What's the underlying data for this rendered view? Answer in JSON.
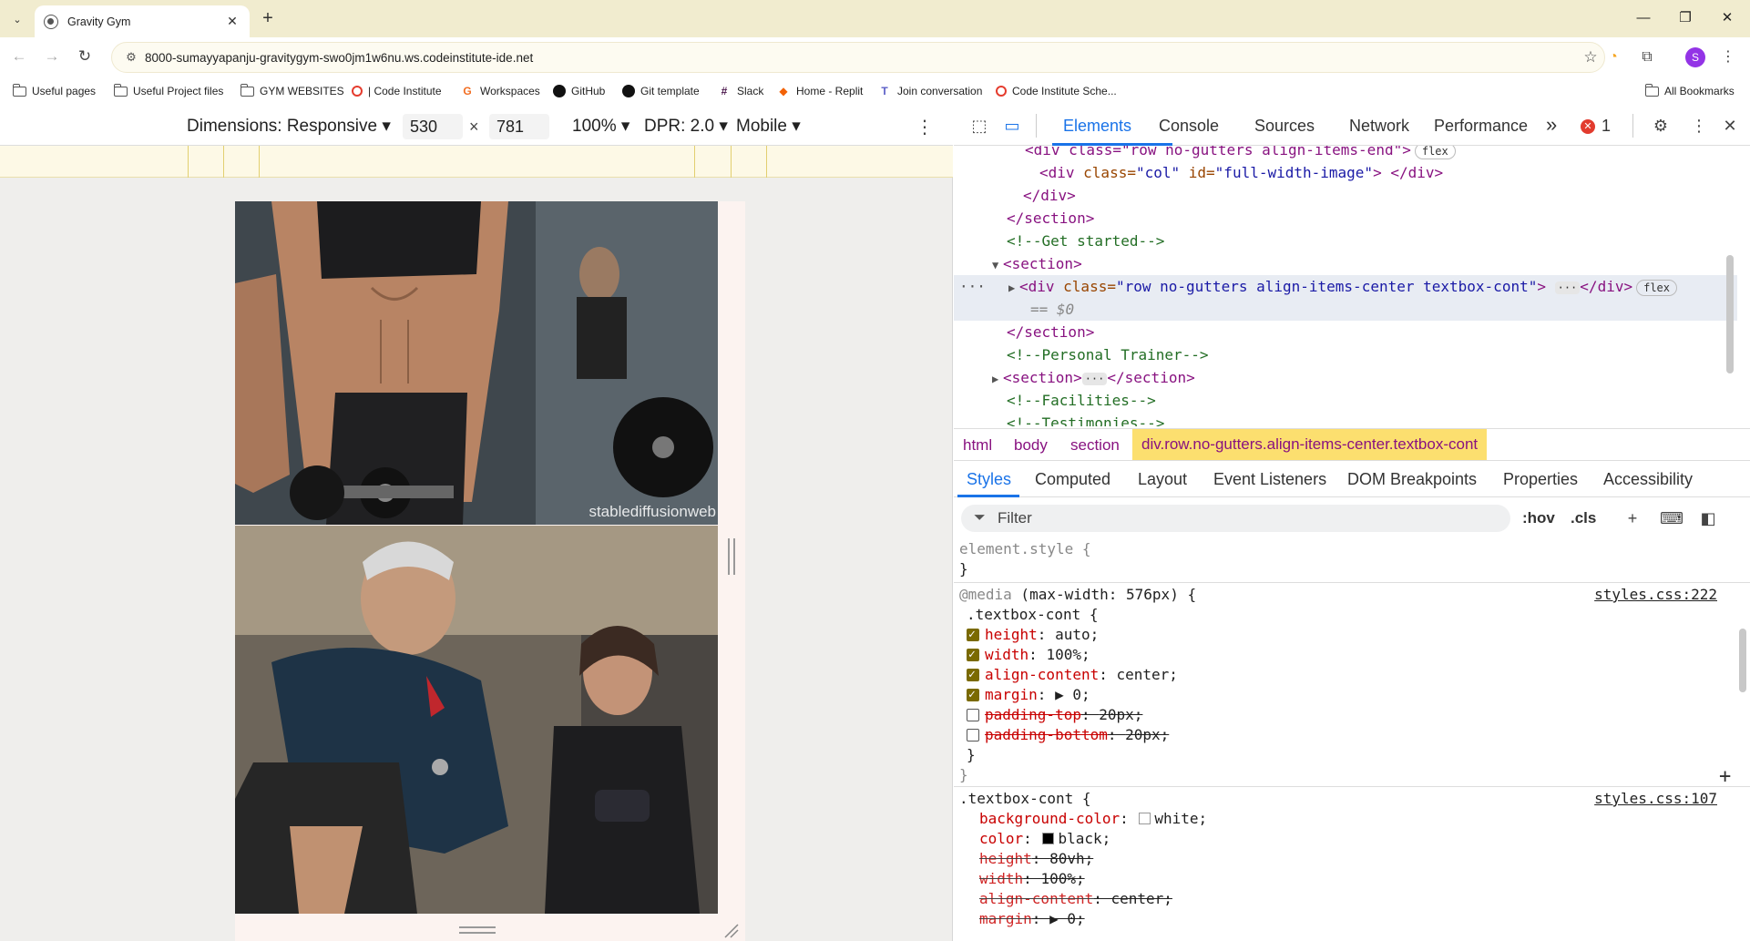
{
  "browser": {
    "tab_title": "Gravity Gym",
    "url": "8000-sumayyapanju-gravitygym-swo0jm1w6nu.ws.codeinstitute-ide.net",
    "avatar_letter": "S",
    "bookmarks": [
      {
        "label": "Useful pages",
        "icon": "folder-icon"
      },
      {
        "label": "Useful Project files",
        "icon": "folder-icon"
      },
      {
        "label": "GYM WEBSITES",
        "icon": "folder-icon"
      },
      {
        "label": "| Code Institute",
        "icon": "code-institute-icon"
      },
      {
        "label": "Workspaces",
        "icon": "workspaces-icon"
      },
      {
        "label": "GitHub",
        "icon": "github-icon"
      },
      {
        "label": "Git template",
        "icon": "github-icon"
      },
      {
        "label": "Slack",
        "icon": "slack-icon"
      },
      {
        "label": "Home - Replit",
        "icon": "replit-icon"
      },
      {
        "label": "Join conversation",
        "icon": "teams-icon"
      },
      {
        "label": "Code Institute Sche...",
        "icon": "code-institute-icon"
      }
    ],
    "all_bookmarks": "All Bookmarks"
  },
  "emulation": {
    "dimensions_label": "Dimensions: Responsive",
    "width": "530",
    "height": "781",
    "times": "×",
    "zoom": "100%",
    "dpr": "DPR: 2.0",
    "mode": "Mobile",
    "watermark": "stablediffusionweb"
  },
  "devtools": {
    "tabs": [
      "Elements",
      "Console",
      "Sources",
      "Network",
      "Performance"
    ],
    "more": "»",
    "error_count": "1",
    "dom": [
      {
        "type": "partial",
        "text": "<div class=\"row no-gutters align-items-end\">",
        "pill": "flex"
      },
      {
        "type": "tag",
        "indent": 2,
        "open": "<div",
        "attr1": " class=",
        "val1": "\"col\"",
        "attr2": " id=",
        "val2": "\"full-width-image\"",
        "close": "> </div>"
      },
      {
        "type": "plain",
        "indent": 1,
        "text": "</div>"
      },
      {
        "type": "plain",
        "indent": 0,
        "text": "</section>"
      },
      {
        "type": "comment",
        "indent": 0,
        "text": "<!--Get started-->"
      },
      {
        "type": "plain",
        "indent": 0,
        "text": "<section>",
        "triangle": "down"
      },
      {
        "type": "selected",
        "indent": 1,
        "open": "<div",
        "attr1": " class=",
        "val1": "\"row no-gutters align-items-center textbox-cont\"",
        "close": "> ",
        "dots": "···",
        "end": "</div>",
        "pill": "flex"
      },
      {
        "type": "eq",
        "text": "== $0"
      },
      {
        "type": "plain",
        "indent": 0,
        "text": "</section>"
      },
      {
        "type": "comment",
        "indent": 0,
        "text": "<!--Personal Trainer-->"
      },
      {
        "type": "collapsed",
        "indent": 0,
        "text": "<section>",
        "dots": "···",
        "end": "</section>"
      },
      {
        "type": "comment",
        "indent": 0,
        "text": "<!--Facilities-->"
      },
      {
        "type": "comment",
        "indent": 0,
        "text": "<!--Testimonies-->"
      }
    ],
    "breadcrumbs": [
      "html",
      "body",
      "section",
      "div.row.no-gutters.align-items-center.textbox-cont"
    ],
    "style_tabs": [
      "Styles",
      "Computed",
      "Layout",
      "Event Listeners",
      "DOM Breakpoints",
      "Properties",
      "Accessibility"
    ],
    "filter_placeholder": "Filter",
    "hov": ":hov",
    "cls": ".cls",
    "element_style": "element.style {",
    "close_brace": "}",
    "media_rule": {
      "at": "@media",
      "query": " (max-width: 576px) {",
      "source": "styles.css:222",
      "selector": ".textbox-cont {",
      "props": [
        {
          "name": "height",
          "value": "auto;",
          "checked": true
        },
        {
          "name": "width",
          "value": "100%;",
          "checked": true
        },
        {
          "name": "align-content",
          "value": "center;",
          "checked": true
        },
        {
          "name": "margin",
          "value": "▶ 0;",
          "checked": true
        },
        {
          "name": "padding-top",
          "value": "20px;",
          "checked": false
        },
        {
          "name": "padding-bottom",
          "value": "20px;",
          "checked": false
        }
      ]
    },
    "base_rule": {
      "selector": ".textbox-cont {",
      "source": "styles.css:107",
      "props": [
        {
          "name": "background-color",
          "value": "white;",
          "swatch": "#ffffff",
          "struck": false
        },
        {
          "name": "color",
          "value": "black;",
          "swatch": "#000000",
          "struck": false
        },
        {
          "name": "height",
          "value": "80vh;",
          "struck": true
        },
        {
          "name": "width",
          "value": "100%;",
          "struck": true
        },
        {
          "name": "align-content",
          "value": "center;",
          "struck": true
        },
        {
          "name": "margin",
          "value": "▶ 0;",
          "struck": true
        }
      ]
    }
  }
}
